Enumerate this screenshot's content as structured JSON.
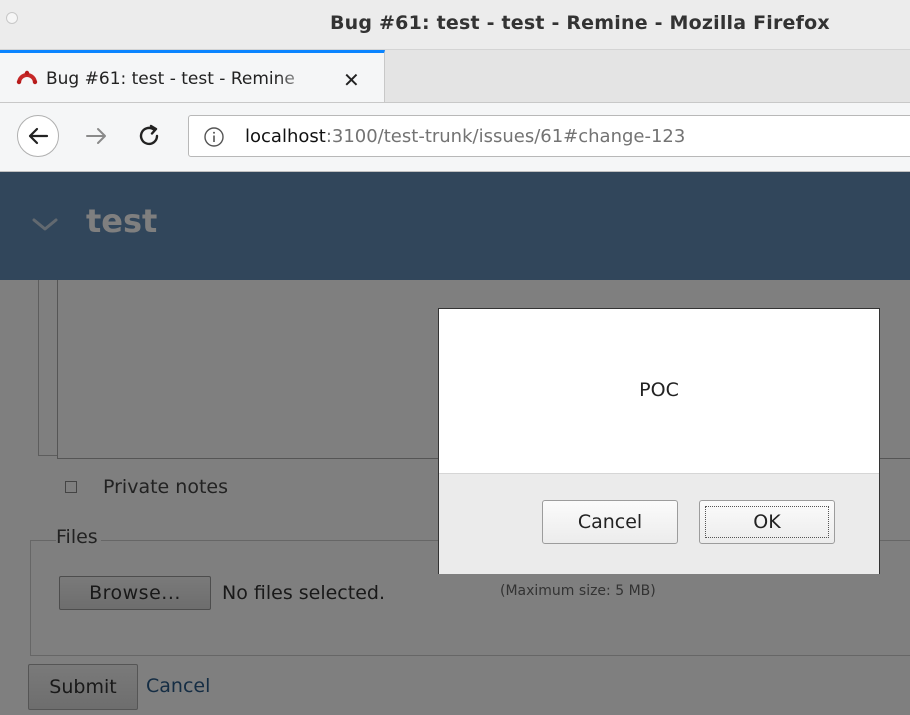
{
  "window": {
    "title": "Bug #61: test - test - Remine - Mozilla Firefox"
  },
  "tab": {
    "label": "Bug #61: test - test - Remine",
    "close_glyph": "✕"
  },
  "navigation": {
    "url_host": "localhost",
    "url_rest": ":3100/test-trunk/issues/61#change-123"
  },
  "header": {
    "project_title": "test"
  },
  "form": {
    "private_notes_label": "Private notes",
    "files_legend": "Files",
    "browse_label": "Browse...",
    "no_files_text": "No files selected.",
    "max_size_text": "(Maximum size: 5 MB)",
    "submit_label": "Submit",
    "cancel_label": "Cancel"
  },
  "dialog": {
    "message": "POC",
    "cancel_label": "Cancel",
    "ok_label": "OK"
  },
  "colors": {
    "header_bg": "#628db6",
    "tab_accent": "#0a84ff",
    "link": "#2a5b88"
  }
}
